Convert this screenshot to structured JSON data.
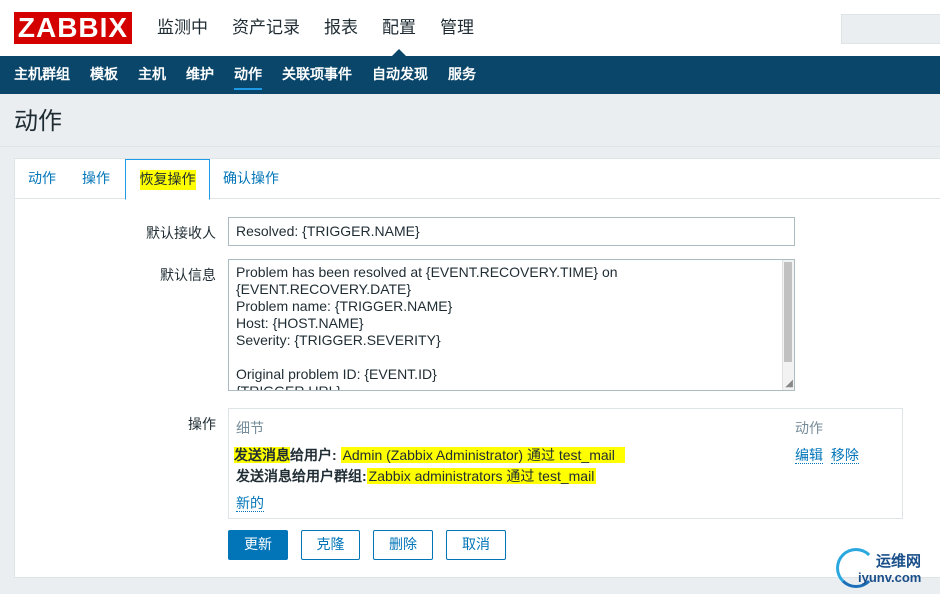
{
  "logo": {
    "text": "ZABBIX"
  },
  "main_menu": [
    "监测中",
    "资产记录",
    "报表",
    "配置",
    "管理"
  ],
  "sub_menu": [
    "主机群组",
    "模板",
    "主机",
    "维护",
    "动作",
    "关联项事件",
    "自动发现",
    "服务"
  ],
  "page_title": "动作",
  "tabs": [
    "动作",
    "操作",
    "恢复操作",
    "确认操作"
  ],
  "form": {
    "recipient_label": "默认接收人",
    "recipient_value": "Resolved: {TRIGGER.NAME}",
    "message_label": "默认信息",
    "message_lines": [
      "Problem has been resolved at {EVENT.RECOVERY.TIME} on",
      "{EVENT.RECOVERY.DATE}",
      "Problem name: {TRIGGER.NAME}",
      "Host: {HOST.NAME}",
      "Severity: {TRIGGER.SEVERITY}",
      "",
      "Original problem ID: {EVENT.ID}",
      "{TRIGGER.URL}"
    ],
    "operations_label": "操作"
  },
  "operations": {
    "col_details": "细节",
    "col_action": "动作",
    "row1_prefix": "发送消息",
    "row1_suffix": "给用户:",
    "row1_value": "Admin (Zabbix Administrator) 通过 test_mail",
    "row2_prefix": "发送消息给用户群组:",
    "row2_value": "Zabbix administrators 通过 test_mail",
    "edit": "编辑",
    "remove": "移除",
    "new": "新的"
  },
  "buttons": {
    "update": "更新",
    "clone": "克隆",
    "delete": "删除",
    "cancel": "取消"
  },
  "watermark": {
    "cn": "运维网",
    "url": "iyunv.com"
  },
  "colors": {
    "brand_red": "#d40000",
    "nav_blue": "#0a466a",
    "link_blue": "#0275b8",
    "highlight": "#ffff00"
  }
}
